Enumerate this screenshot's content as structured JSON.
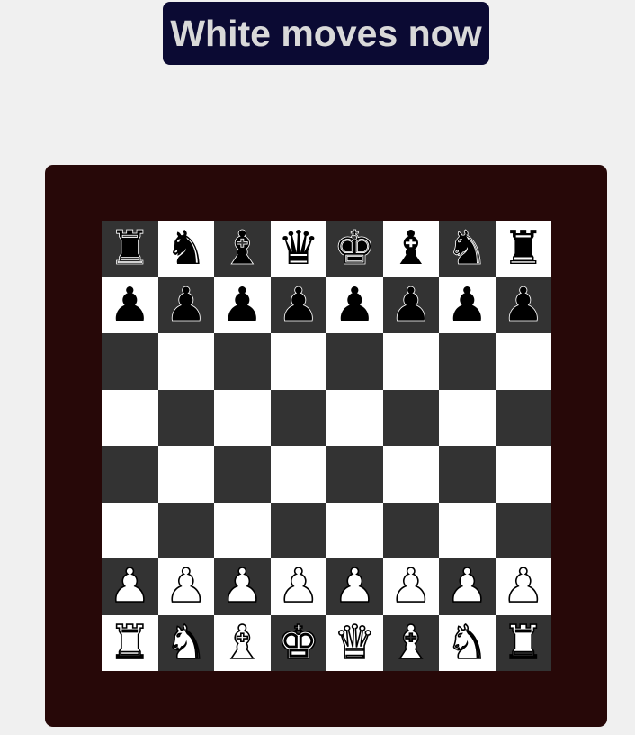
{
  "status": {
    "text": "White moves now"
  },
  "colors": {
    "page_background": "#f0f0f0",
    "banner_background": "#0b0a33",
    "banner_text": "#d9d9d9",
    "board_frame": "#270808",
    "light_square": "#ffffff",
    "dark_square": "#333333"
  },
  "board": {
    "top_left_square": "dark",
    "ranks": [
      [
        "bR",
        "bN",
        "bB",
        "bQ",
        "bK",
        "bB",
        "bN",
        "bR"
      ],
      [
        "bP",
        "bP",
        "bP",
        "bP",
        "bP",
        "bP",
        "bP",
        "bP"
      ],
      [
        "",
        "",
        "",
        "",
        "",
        "",
        "",
        ""
      ],
      [
        "",
        "",
        "",
        "",
        "",
        "",
        "",
        ""
      ],
      [
        "",
        "",
        "",
        "",
        "",
        "",
        "",
        ""
      ],
      [
        "",
        "",
        "",
        "",
        "",
        "",
        "",
        ""
      ],
      [
        "wP",
        "wP",
        "wP",
        "wP",
        "wP",
        "wP",
        "wP",
        "wP"
      ],
      [
        "wR",
        "wN",
        "wB",
        "wK",
        "wQ",
        "wB",
        "wN",
        "wR"
      ]
    ]
  },
  "piece_icons": {
    "K": "king-icon",
    "Q": "queen-icon",
    "R": "rook-icon",
    "B": "bishop-icon",
    "N": "knight-icon",
    "P": "pawn-icon"
  }
}
